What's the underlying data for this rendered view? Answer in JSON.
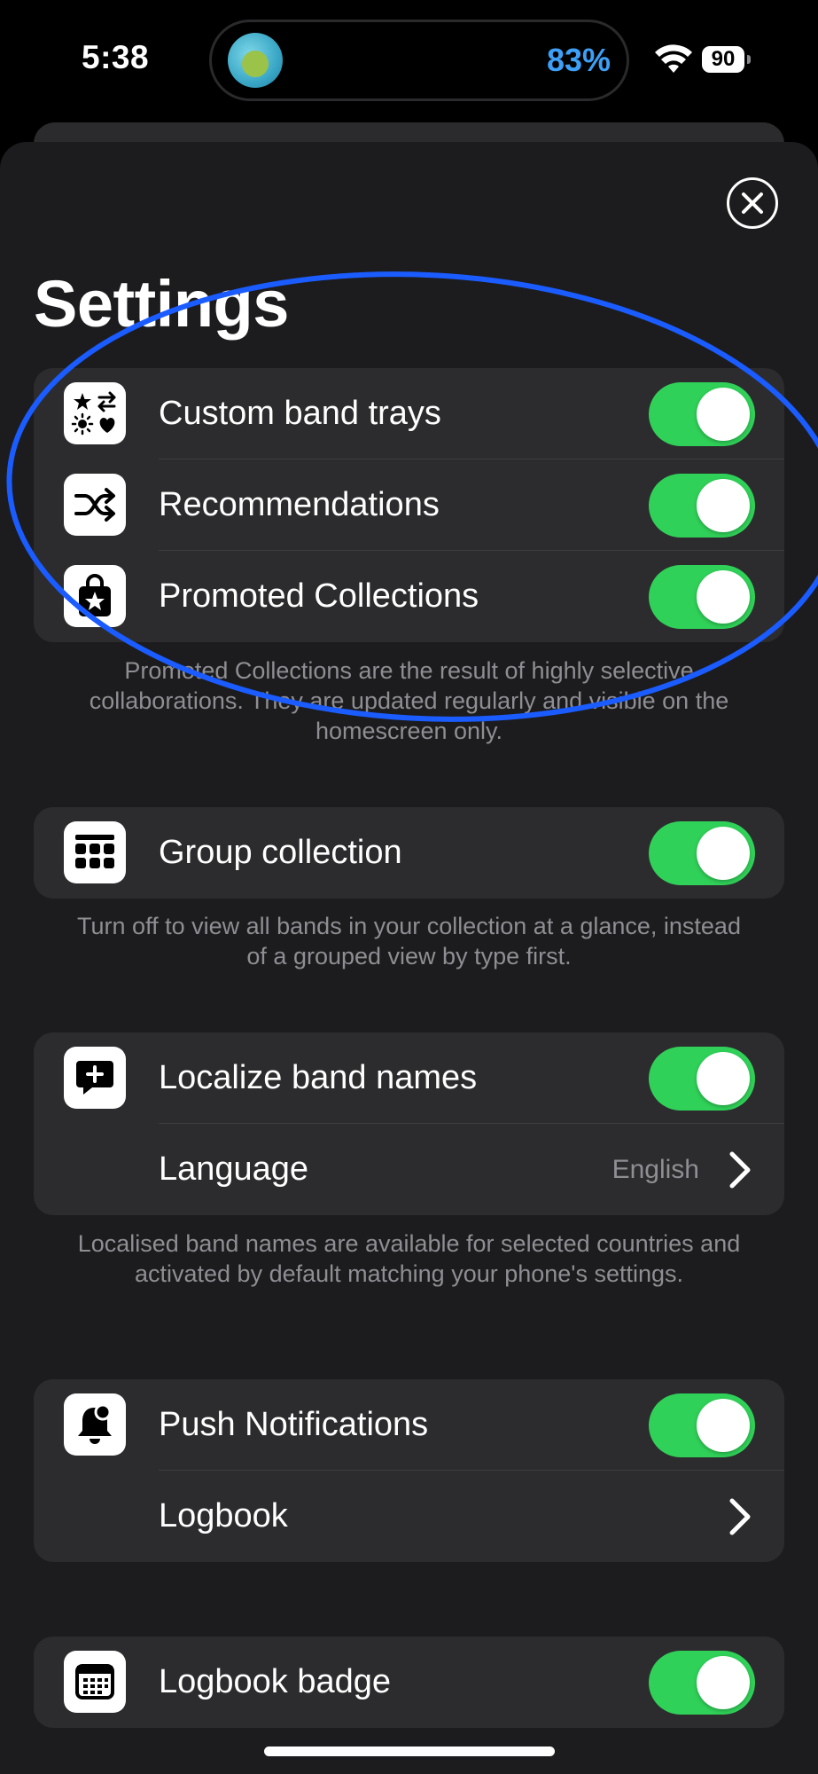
{
  "status_bar": {
    "time": "5:38",
    "activity_percent": "83%",
    "battery_level": "90"
  },
  "page": {
    "title": "Settings"
  },
  "groups": [
    {
      "rows": [
        {
          "label": "Custom band trays",
          "icon": "star-shuffle-icon",
          "toggle_on": true
        },
        {
          "label": "Recommendations",
          "icon": "shuffle-icon",
          "toggle_on": true
        },
        {
          "label": "Promoted Collections",
          "icon": "star-bag-icon",
          "toggle_on": true
        }
      ],
      "footnote": "Promoted Collections are the result of highly selective collaborations. They are updated regularly and visible on the homescreen only."
    },
    {
      "rows": [
        {
          "label": "Group collection",
          "icon": "grid-icon",
          "toggle_on": true
        }
      ],
      "footnote": "Turn off to view all bands in your collection at a glance, instead of a grouped view by type first."
    },
    {
      "rows": [
        {
          "label": "Localize band names",
          "icon": "speech-bubble-plus-icon",
          "toggle_on": true
        },
        {
          "label": "Language",
          "value": "English"
        }
      ],
      "footnote": "Localised band names are available for selected countries and activated by default matching your phone's settings."
    },
    {
      "rows": [
        {
          "label": "Push Notifications",
          "icon": "bell-icon",
          "toggle_on": true
        },
        {
          "label": "Logbook"
        }
      ]
    },
    {
      "rows": [
        {
          "label": "Logbook badge",
          "icon": "calendar-icon",
          "toggle_on": true
        }
      ]
    }
  ],
  "colors": {
    "toggle_on": "#30d158",
    "annotation": "#1a5cff",
    "sheet_background": "#1c1c1e",
    "group_background": "#2c2c2e"
  }
}
